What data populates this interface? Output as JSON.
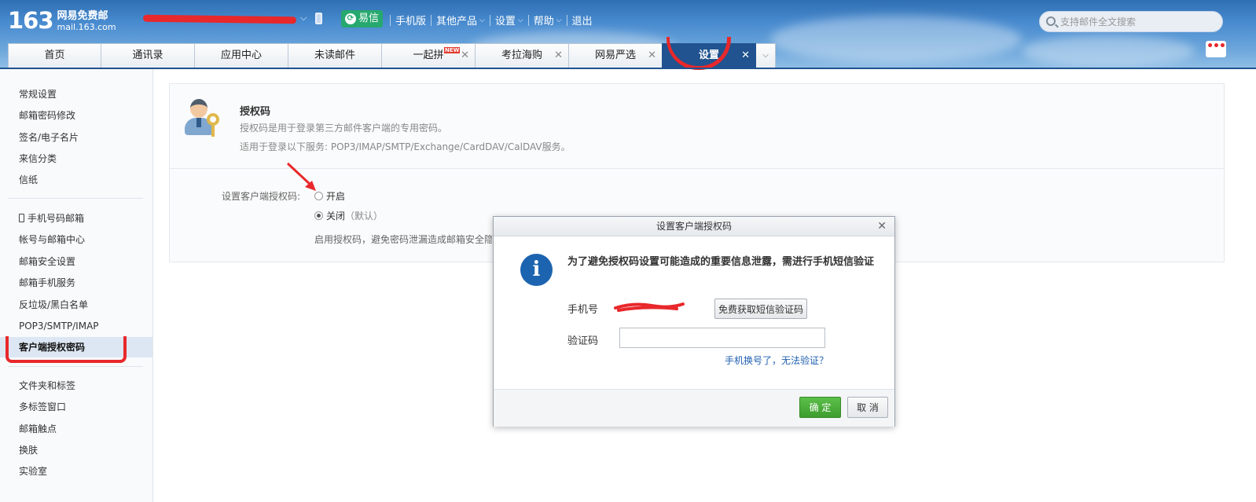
{
  "header": {
    "logo_number": "163",
    "logo_cn": "网易免费邮",
    "logo_en": "mail.163.com",
    "yixin_label": "易信",
    "nav": [
      {
        "label": "手机版"
      },
      {
        "label": "其他产品",
        "has_caret": true
      },
      {
        "label": "设置",
        "has_caret": true
      },
      {
        "label": "帮助",
        "has_caret": true
      },
      {
        "label": "退出"
      }
    ],
    "search_placeholder": "支持邮件全文搜索"
  },
  "tabs": [
    {
      "label": "首页"
    },
    {
      "label": "通讯录"
    },
    {
      "label": "应用中心"
    },
    {
      "label": "未读邮件"
    },
    {
      "label": "一起拼",
      "badge": "NEW",
      "closable": true
    },
    {
      "label": "考拉海购",
      "closable": true
    },
    {
      "label": "网易严选",
      "closable": true
    },
    {
      "label": "设置",
      "closable": true,
      "active": true
    }
  ],
  "sidebar": {
    "group1": [
      "常规设置",
      "邮箱密码修改",
      "签名/电子名片",
      "来信分类",
      "信纸"
    ],
    "group2": [
      "手机号码邮箱",
      "帐号与邮箱中心",
      "邮箱安全设置",
      "邮箱手机服务",
      "反垃圾/黑白名单",
      "POP3/SMTP/IMAP",
      "客户端授权密码"
    ],
    "group3": [
      "文件夹和标签",
      "多标签窗口",
      "邮箱触点",
      "换肤",
      "实验室"
    ],
    "active": "客户端授权密码"
  },
  "panel": {
    "title": "授权码",
    "desc1": "授权码是用于登录第三方邮件客户端的专用密码。",
    "desc2": "适用于登录以下服务: POP3/IMAP/SMTP/Exchange/CardDAV/CalDAV服务。",
    "setting_label": "设置客户端授权码:",
    "option_on": "开启",
    "option_off": "关闭",
    "option_off_hint": "（默认）",
    "selected": "off",
    "note": "启用授权码，避免密码泄漏造成邮箱安全隐患"
  },
  "dialog": {
    "title": "设置客户端授权码",
    "message": "为了避免授权码设置可能造成的重要信息泄露，需进行手机短信验证",
    "phone_label": "手机号",
    "get_code_label": "免费获取短信验证码",
    "code_label": "验证码",
    "code_value": "",
    "link_label": "手机换号了，无法验证？",
    "ok_label": "确 定",
    "cancel_label": "取 消"
  },
  "colors": {
    "accent_red": "#e8282b",
    "tab_active": "#20538f",
    "ok_green": "#3d9d2e",
    "link_blue": "#1f5fb0"
  }
}
